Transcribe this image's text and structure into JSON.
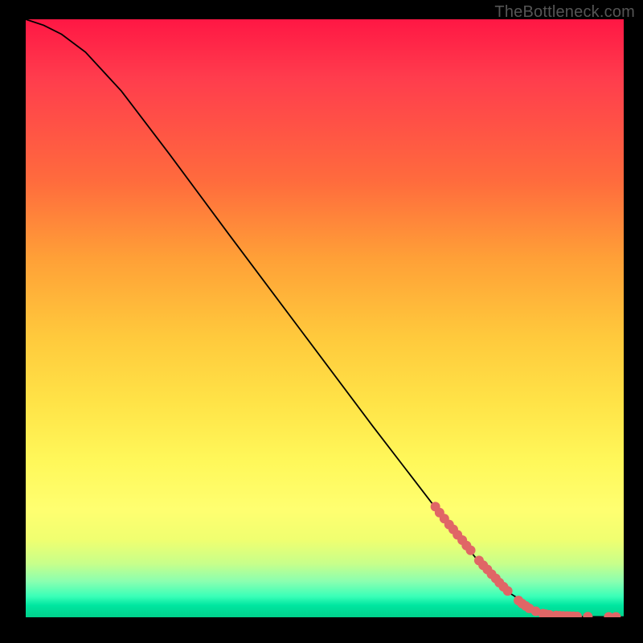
{
  "watermark": "TheBottleneck.com",
  "chart_data": {
    "type": "line",
    "title": "",
    "xlabel": "",
    "ylabel": "",
    "xlim": [
      0,
      100
    ],
    "ylim": [
      0,
      100
    ],
    "grid": false,
    "legend": false,
    "series": [
      {
        "name": "curve",
        "x": [
          0,
          3,
          6,
          10,
          16,
          24,
          34,
          46,
          58,
          68,
          76,
          81,
          85,
          88,
          91,
          93,
          100
        ],
        "y": [
          100,
          99,
          97.5,
          94.5,
          88,
          77.5,
          64,
          48,
          32,
          19,
          9,
          4,
          1.5,
          0.5,
          0.2,
          0.1,
          0.05
        ]
      }
    ],
    "markers": {
      "name": "highlighted-points",
      "color_hex": "#e06666",
      "points": [
        {
          "x": 68.5,
          "y": 18.5
        },
        {
          "x": 69.2,
          "y": 17.5
        },
        {
          "x": 70.0,
          "y": 16.5
        },
        {
          "x": 70.8,
          "y": 15.5
        },
        {
          "x": 71.5,
          "y": 14.7
        },
        {
          "x": 72.2,
          "y": 13.8
        },
        {
          "x": 73.0,
          "y": 12.9
        },
        {
          "x": 73.7,
          "y": 12.0
        },
        {
          "x": 74.4,
          "y": 11.2
        },
        {
          "x": 75.8,
          "y": 9.5
        },
        {
          "x": 76.5,
          "y": 8.7
        },
        {
          "x": 77.2,
          "y": 8.0
        },
        {
          "x": 77.9,
          "y": 7.2
        },
        {
          "x": 78.6,
          "y": 6.5
        },
        {
          "x": 79.2,
          "y": 5.8
        },
        {
          "x": 79.9,
          "y": 5.1
        },
        {
          "x": 80.6,
          "y": 4.4
        },
        {
          "x": 82.4,
          "y": 2.8
        },
        {
          "x": 83.0,
          "y": 2.3
        },
        {
          "x": 83.6,
          "y": 1.9
        },
        {
          "x": 84.2,
          "y": 1.5
        },
        {
          "x": 85.3,
          "y": 1.0
        },
        {
          "x": 86.5,
          "y": 0.6
        },
        {
          "x": 87.0,
          "y": 0.5
        },
        {
          "x": 87.6,
          "y": 0.4
        },
        {
          "x": 88.7,
          "y": 0.3
        },
        {
          "x": 89.3,
          "y": 0.25
        },
        {
          "x": 89.9,
          "y": 0.22
        },
        {
          "x": 90.5,
          "y": 0.2
        },
        {
          "x": 91.0,
          "y": 0.18
        },
        {
          "x": 91.6,
          "y": 0.16
        },
        {
          "x": 92.2,
          "y": 0.14
        },
        {
          "x": 94.0,
          "y": 0.1
        },
        {
          "x": 97.5,
          "y": 0.07
        },
        {
          "x": 98.7,
          "y": 0.06
        }
      ]
    },
    "background_gradient": {
      "type": "vertical",
      "stops": [
        {
          "pos": 0.0,
          "color": "#ff1744"
        },
        {
          "pos": 0.27,
          "color": "#ff6b3d"
        },
        {
          "pos": 0.53,
          "color": "#ffc93c"
        },
        {
          "pos": 0.74,
          "color": "#fff85a"
        },
        {
          "pos": 0.91,
          "color": "#c8ff8a"
        },
        {
          "pos": 1.0,
          "color": "#00d28c"
        }
      ]
    }
  }
}
